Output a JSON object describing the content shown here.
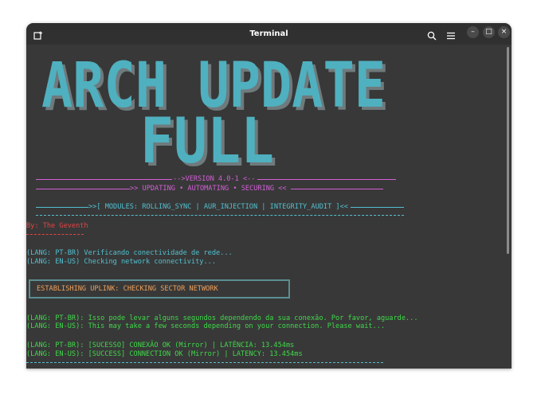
{
  "window": {
    "title": "Terminal",
    "new_tab_icon": "new-tab-icon",
    "search_icon": "search-icon",
    "menu_icon": "hamburger-menu-icon",
    "minimize_label": "–",
    "maximize_label": "□",
    "close_label": "×"
  },
  "banner": {
    "line1": "ARCH UPDATE",
    "line2": "FULL",
    "color": "#4fb0bf",
    "shadow_color": "#6f7a7c"
  },
  "terminal": {
    "version": "-->VERSION 4.0-1 <--",
    "tagline": ">> UPDATING • AUTOMATING • SECURING <<",
    "modules": ">>[ MODULES: ROLLING_SYNC | AUR_INJECTION | INTEGRITY_AUDIT ]<<",
    "author": "By: The Geventh",
    "conn_pt": "(LANG: PT-BR) Verificando conectividade de rede...",
    "conn_en": "(LANG: EN-US) Checking network connectivity...",
    "uplink": "ESTABLISHING UPLINK: CHECKING SECTOR NETWORK",
    "wait_pt": "(LANG: PT-BR): Isso pode levar alguns segundos dependendo da sua conexão. Por favor, aguarde...",
    "wait_en": "(LANG: EN-US): This may take a few seconds depending on your connection. Please wait...",
    "ok_pt": "(LANG: PT-BR): [SUCESSO] CONEXÃO OK (Mirror) | LATÊNCIA: 13.454ms",
    "ok_en": "(LANG: EN-US): [SUCCESS] CONNECTION OK (Mirror) | LATENCY: 13.454ms"
  },
  "colors": {
    "background": "#383838",
    "magenta": "#d35fd7",
    "cyan": "#52c0d0",
    "red": "#e04444",
    "green": "#3fd94a",
    "orange": "#f0a058",
    "box_border": "#5c8d92"
  }
}
